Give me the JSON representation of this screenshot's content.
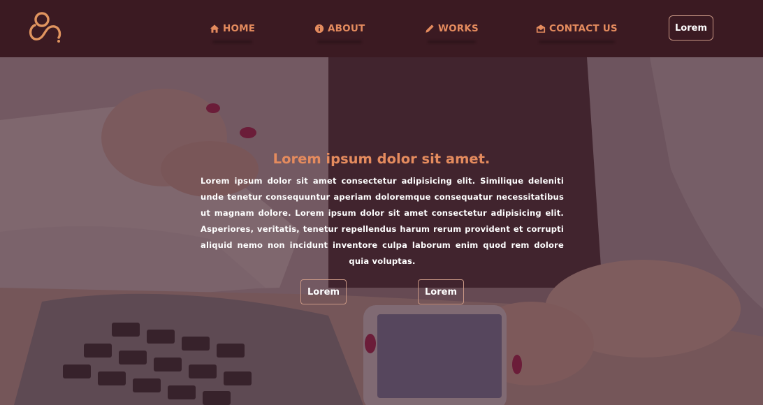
{
  "nav": {
    "items": [
      {
        "label": "HOME",
        "icon": "home-icon"
      },
      {
        "label": "ABOUT",
        "icon": "info-icon"
      },
      {
        "label": "WORKS",
        "icon": "pencil-icon"
      },
      {
        "label": "CONTACT US",
        "icon": "envelope-open-icon"
      }
    ],
    "cta_label": "Lorem"
  },
  "hero": {
    "title": "Lorem ipsum dolor sit amet.",
    "body": "Lorem ipsum dolor sit amet consectetur adipisicing elit. Similique deleniti unde tenetur consequuntur aperiam doloremque consequatur necessitatibus ut magnam dolore. Lorem ipsum dolor sit amet consectetur adipisicing elit. Asperiores, veritatis, tenetur repellendus harum rerum provident et corrupti aliquid nemo non incidunt inventore culpa laborum enim quod rem dolore quia voluptas.",
    "buttons": [
      {
        "label": "Lorem"
      },
      {
        "label": "Lorem"
      }
    ]
  },
  "colors": {
    "navbar_bg": "#3b1a22",
    "accent": "#e48b5e",
    "overlay": "#3a1622",
    "button_border": "#c99785"
  }
}
